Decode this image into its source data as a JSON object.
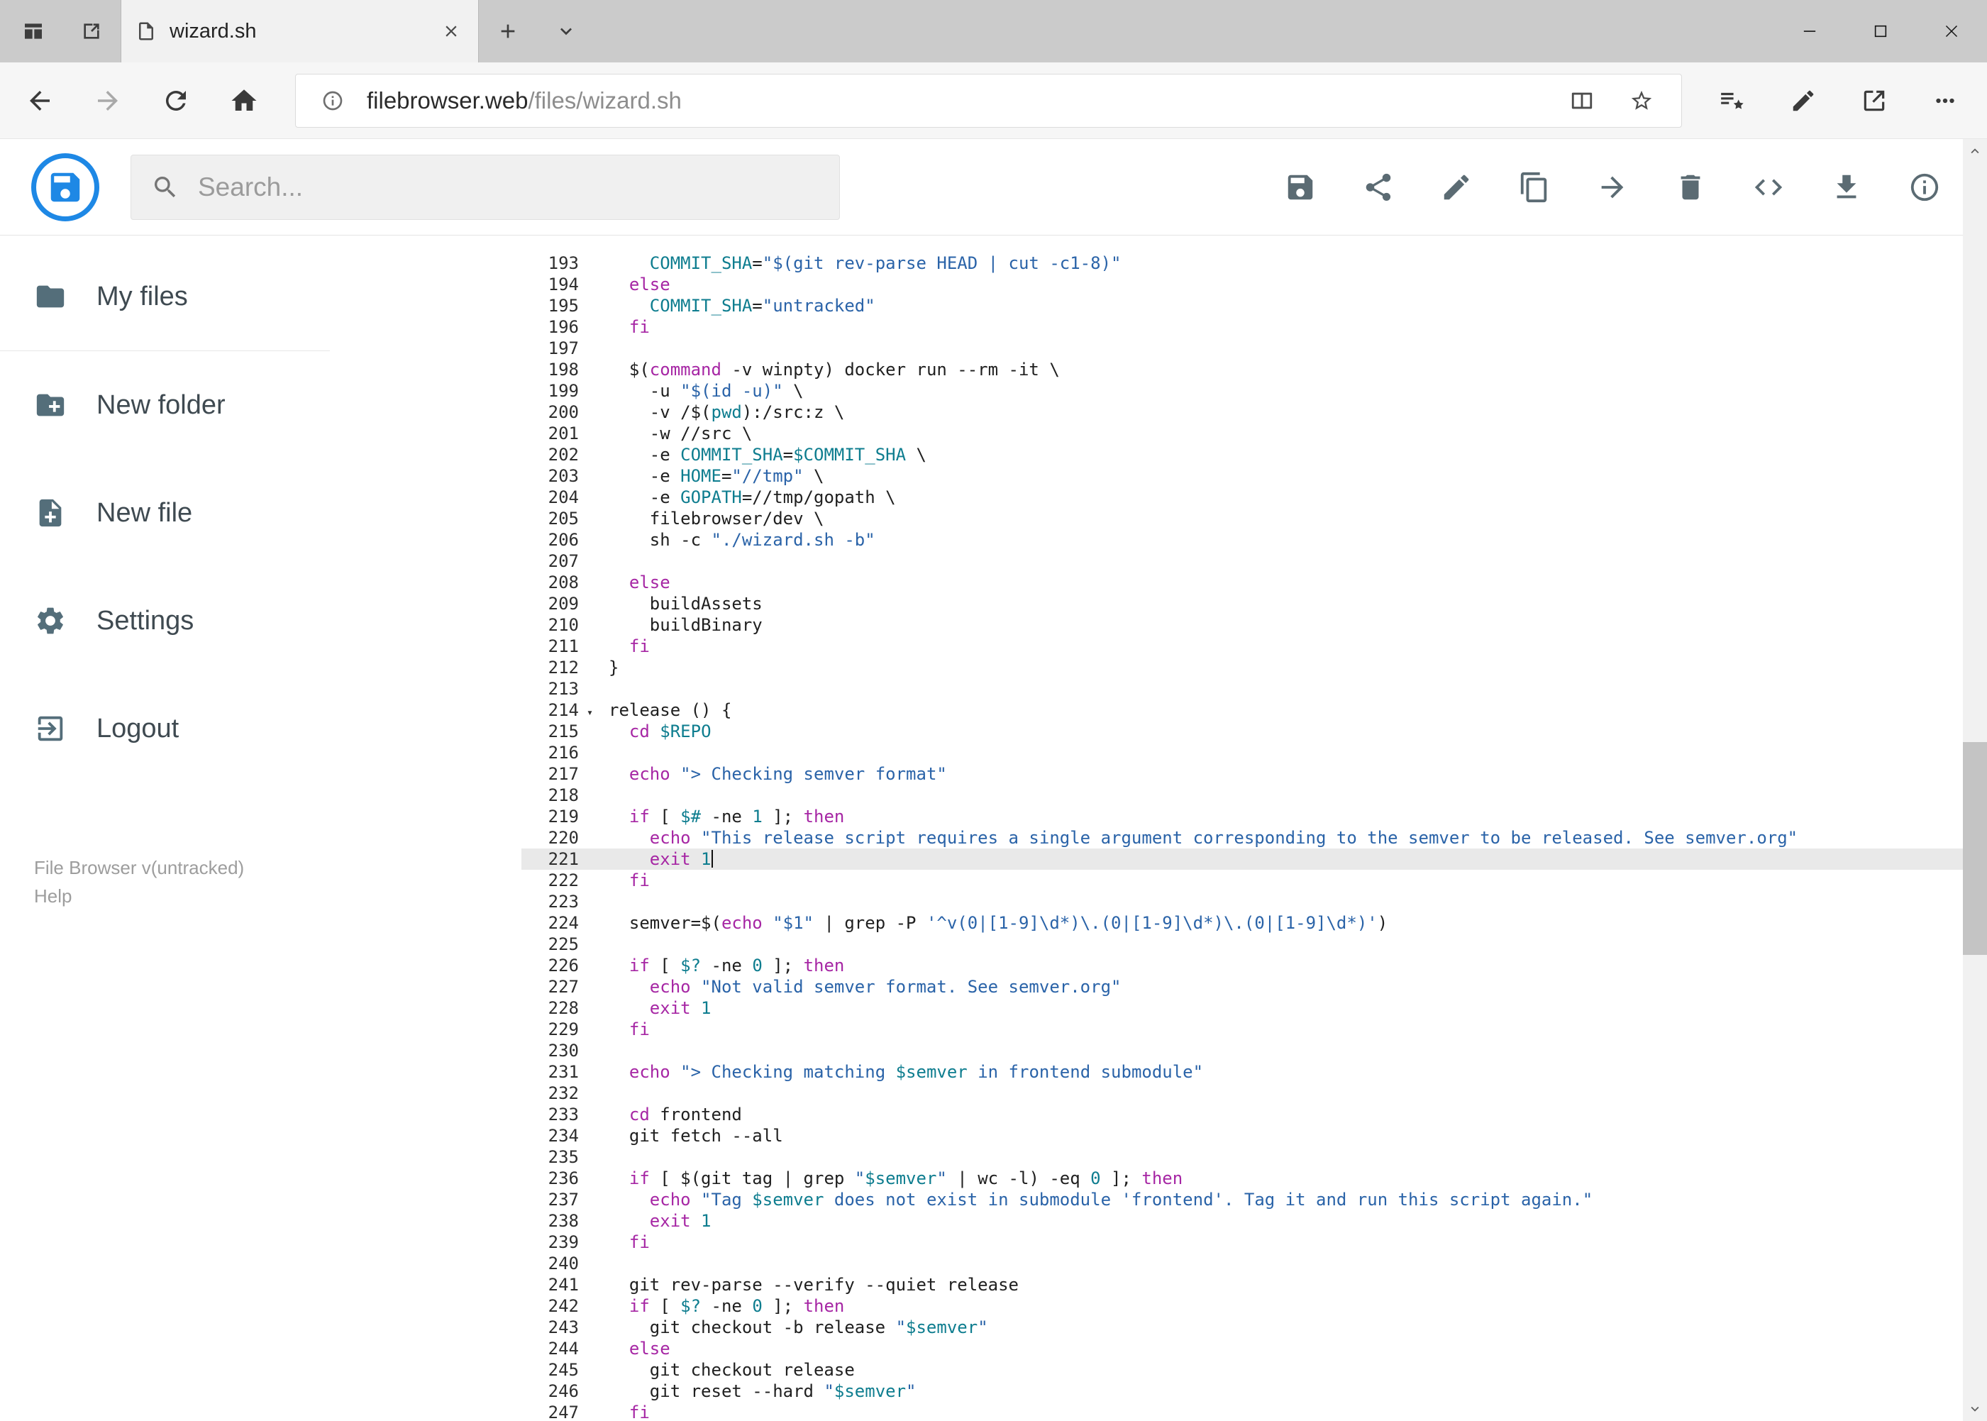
{
  "window": {
    "tab": {
      "title": "wizard.sh"
    }
  },
  "browser": {
    "url_host": "filebrowser.web",
    "url_path": "/files/wizard.sh"
  },
  "theme": {
    "accent_blue": "#1e88e5",
    "keyword": "#a626a4",
    "string": "#2a63a8",
    "variable": "#0e7d8f",
    "number": "#0e7d8f",
    "plain": "#202020",
    "active_line_bg": "#e9e9e9",
    "icon_gray": "#5b6b73"
  },
  "header": {
    "search_placeholder": "Search...",
    "actions": [
      {
        "name": "save-button",
        "icon": "save-icon",
        "symbol": "sym-save"
      },
      {
        "name": "share-button",
        "icon": "share-icon",
        "symbol": "sym-share"
      },
      {
        "name": "rename-button",
        "icon": "pencil-icon",
        "symbol": "sym-pencil"
      },
      {
        "name": "copy-button",
        "icon": "copy-icon",
        "symbol": "sym-copy"
      },
      {
        "name": "move-button",
        "icon": "arrow-right-icon",
        "symbol": "sym-forward"
      },
      {
        "name": "delete-button",
        "icon": "trash-icon",
        "symbol": "sym-trash"
      },
      {
        "name": "editor-mode-button",
        "icon": "code-icon",
        "symbol": "sym-code"
      },
      {
        "name": "download-button",
        "icon": "download-icon",
        "symbol": "sym-download"
      },
      {
        "name": "info-button",
        "icon": "info-icon",
        "symbol": "sym-info"
      }
    ]
  },
  "sidebar": {
    "items": [
      {
        "id": "my-files",
        "label": "My files",
        "icon": "folder-icon",
        "symbol": "sym-folder",
        "divider_after": true
      },
      {
        "id": "new-folder",
        "label": "New folder",
        "icon": "folder-plus-icon",
        "symbol": "sym-folder-plus"
      },
      {
        "id": "new-file",
        "label": "New file",
        "icon": "file-plus-icon",
        "symbol": "sym-file-plus"
      },
      {
        "id": "settings",
        "label": "Settings",
        "icon": "gear-icon",
        "symbol": "sym-gear"
      },
      {
        "id": "logout",
        "label": "Logout",
        "icon": "logout-icon",
        "symbol": "sym-logout"
      }
    ],
    "footer": {
      "version": "File Browser v(untracked)",
      "help": "Help"
    }
  },
  "editor": {
    "active_line": 221,
    "first_visible_line": 193,
    "lines": [
      {
        "n": 193,
        "seg": [
          [
            "p",
            "    "
          ],
          [
            "v",
            "COMMIT_SHA"
          ],
          [
            "p",
            "="
          ],
          [
            "s",
            "\"$(git rev-parse HEAD | cut -c1-8)\""
          ]
        ]
      },
      {
        "n": 194,
        "seg": [
          [
            "p",
            "  "
          ],
          [
            "k",
            "else"
          ]
        ]
      },
      {
        "n": 195,
        "seg": [
          [
            "p",
            "    "
          ],
          [
            "v",
            "COMMIT_SHA"
          ],
          [
            "p",
            "="
          ],
          [
            "s",
            "\"untracked\""
          ]
        ]
      },
      {
        "n": 196,
        "seg": [
          [
            "p",
            "  "
          ],
          [
            "k",
            "fi"
          ]
        ]
      },
      {
        "n": 197,
        "seg": []
      },
      {
        "n": 198,
        "seg": [
          [
            "p",
            "  $("
          ],
          [
            "k",
            "command"
          ],
          [
            "p",
            " -v winpty) docker run --rm -it \\"
          ]
        ]
      },
      {
        "n": 199,
        "seg": [
          [
            "p",
            "    -u "
          ],
          [
            "s",
            "\"$(id -u)\""
          ],
          [
            "p",
            " \\"
          ]
        ]
      },
      {
        "n": 200,
        "seg": [
          [
            "p",
            "    -v /$("
          ],
          [
            "v",
            "pwd"
          ],
          [
            "p",
            "):/src:z \\"
          ]
        ]
      },
      {
        "n": 201,
        "seg": [
          [
            "p",
            "    -w //src \\"
          ]
        ]
      },
      {
        "n": 202,
        "seg": [
          [
            "p",
            "    -e "
          ],
          [
            "v",
            "COMMIT_SHA"
          ],
          [
            "p",
            "="
          ],
          [
            "v",
            "$COMMIT_SHA"
          ],
          [
            "p",
            " \\"
          ]
        ]
      },
      {
        "n": 203,
        "seg": [
          [
            "p",
            "    -e "
          ],
          [
            "v",
            "HOME"
          ],
          [
            "p",
            "="
          ],
          [
            "s",
            "\"//tmp\""
          ],
          [
            "p",
            " \\"
          ]
        ]
      },
      {
        "n": 204,
        "seg": [
          [
            "p",
            "    -e "
          ],
          [
            "v",
            "GOPATH"
          ],
          [
            "p",
            "=//tmp/gopath \\"
          ]
        ]
      },
      {
        "n": 205,
        "seg": [
          [
            "p",
            "    filebrowser/dev \\"
          ]
        ]
      },
      {
        "n": 206,
        "seg": [
          [
            "p",
            "    sh -c "
          ],
          [
            "s",
            "\"./wizard.sh -b\""
          ]
        ]
      },
      {
        "n": 207,
        "seg": []
      },
      {
        "n": 208,
        "seg": [
          [
            "p",
            "  "
          ],
          [
            "k",
            "else"
          ]
        ]
      },
      {
        "n": 209,
        "seg": [
          [
            "p",
            "    buildAssets"
          ]
        ]
      },
      {
        "n": 210,
        "seg": [
          [
            "p",
            "    buildBinary"
          ]
        ]
      },
      {
        "n": 211,
        "seg": [
          [
            "p",
            "  "
          ],
          [
            "k",
            "fi"
          ]
        ]
      },
      {
        "n": 212,
        "seg": [
          [
            "p",
            "}"
          ]
        ]
      },
      {
        "n": 213,
        "seg": []
      },
      {
        "n": 214,
        "fold": true,
        "seg": [
          [
            "p",
            "release () {"
          ]
        ]
      },
      {
        "n": 215,
        "seg": [
          [
            "p",
            "  "
          ],
          [
            "k",
            "cd"
          ],
          [
            "p",
            " "
          ],
          [
            "v",
            "$REPO"
          ]
        ]
      },
      {
        "n": 216,
        "seg": []
      },
      {
        "n": 217,
        "seg": [
          [
            "p",
            "  "
          ],
          [
            "k",
            "echo"
          ],
          [
            "p",
            " "
          ],
          [
            "s",
            "\"> Checking semver format\""
          ]
        ]
      },
      {
        "n": 218,
        "seg": []
      },
      {
        "n": 219,
        "seg": [
          [
            "p",
            "  "
          ],
          [
            "k",
            "if"
          ],
          [
            "p",
            " [ "
          ],
          [
            "v",
            "$#"
          ],
          [
            "p",
            " -ne "
          ],
          [
            "n",
            "1"
          ],
          [
            "p",
            " ]; "
          ],
          [
            "k",
            "then"
          ]
        ]
      },
      {
        "n": 220,
        "seg": [
          [
            "p",
            "    "
          ],
          [
            "k",
            "echo"
          ],
          [
            "p",
            " "
          ],
          [
            "s",
            "\"This release script requires a single argument corresponding to the semver to be released. See semver.org\""
          ]
        ]
      },
      {
        "n": 221,
        "seg": [
          [
            "p",
            "    "
          ],
          [
            "k",
            "exit"
          ],
          [
            "p",
            " "
          ],
          [
            "n",
            "1"
          ]
        ]
      },
      {
        "n": 222,
        "seg": [
          [
            "p",
            "  "
          ],
          [
            "k",
            "fi"
          ]
        ]
      },
      {
        "n": 223,
        "seg": []
      },
      {
        "n": 224,
        "seg": [
          [
            "p",
            "  semver=$("
          ],
          [
            "k",
            "echo"
          ],
          [
            "p",
            " "
          ],
          [
            "s",
            "\"$1\""
          ],
          [
            "p",
            " | grep -P "
          ],
          [
            "s",
            "'^v(0|[1-9]\\d*)\\.(0|[1-9]\\d*)\\.(0|[1-9]\\d*)'"
          ],
          [
            "p",
            ")"
          ]
        ]
      },
      {
        "n": 225,
        "seg": []
      },
      {
        "n": 226,
        "seg": [
          [
            "p",
            "  "
          ],
          [
            "k",
            "if"
          ],
          [
            "p",
            " [ "
          ],
          [
            "v",
            "$?"
          ],
          [
            "p",
            " -ne "
          ],
          [
            "n",
            "0"
          ],
          [
            "p",
            " ]; "
          ],
          [
            "k",
            "then"
          ]
        ]
      },
      {
        "n": 227,
        "seg": [
          [
            "p",
            "    "
          ],
          [
            "k",
            "echo"
          ],
          [
            "p",
            " "
          ],
          [
            "s",
            "\"Not valid semver format. See semver.org\""
          ]
        ]
      },
      {
        "n": 228,
        "seg": [
          [
            "p",
            "    "
          ],
          [
            "k",
            "exit"
          ],
          [
            "p",
            " "
          ],
          [
            "n",
            "1"
          ]
        ]
      },
      {
        "n": 229,
        "seg": [
          [
            "p",
            "  "
          ],
          [
            "k",
            "fi"
          ]
        ]
      },
      {
        "n": 230,
        "seg": []
      },
      {
        "n": 231,
        "seg": [
          [
            "p",
            "  "
          ],
          [
            "k",
            "echo"
          ],
          [
            "p",
            " "
          ],
          [
            "s",
            "\"> Checking matching "
          ],
          [
            "v",
            "$semver"
          ],
          [
            "s",
            " in frontend submodule\""
          ]
        ]
      },
      {
        "n": 232,
        "seg": []
      },
      {
        "n": 233,
        "seg": [
          [
            "p",
            "  "
          ],
          [
            "k",
            "cd"
          ],
          [
            "p",
            " frontend"
          ]
        ]
      },
      {
        "n": 234,
        "seg": [
          [
            "p",
            "  git fetch --all"
          ]
        ]
      },
      {
        "n": 235,
        "seg": []
      },
      {
        "n": 236,
        "seg": [
          [
            "p",
            "  "
          ],
          [
            "k",
            "if"
          ],
          [
            "p",
            " [ $(git tag | grep "
          ],
          [
            "s",
            "\""
          ],
          [
            "v",
            "$semver"
          ],
          [
            "s",
            "\""
          ],
          [
            "p",
            " | wc -l) -eq "
          ],
          [
            "n",
            "0"
          ],
          [
            "p",
            " ]; "
          ],
          [
            "k",
            "then"
          ]
        ]
      },
      {
        "n": 237,
        "seg": [
          [
            "p",
            "    "
          ],
          [
            "k",
            "echo"
          ],
          [
            "p",
            " "
          ],
          [
            "s",
            "\"Tag "
          ],
          [
            "v",
            "$semver"
          ],
          [
            "s",
            " does not exist in submodule 'frontend'. Tag it and run this script again.\""
          ]
        ]
      },
      {
        "n": 238,
        "seg": [
          [
            "p",
            "    "
          ],
          [
            "k",
            "exit"
          ],
          [
            "p",
            " "
          ],
          [
            "n",
            "1"
          ]
        ]
      },
      {
        "n": 239,
        "seg": [
          [
            "p",
            "  "
          ],
          [
            "k",
            "fi"
          ]
        ]
      },
      {
        "n": 240,
        "seg": []
      },
      {
        "n": 241,
        "seg": [
          [
            "p",
            "  git rev-parse --verify --quiet release"
          ]
        ]
      },
      {
        "n": 242,
        "seg": [
          [
            "p",
            "  "
          ],
          [
            "k",
            "if"
          ],
          [
            "p",
            " [ "
          ],
          [
            "v",
            "$?"
          ],
          [
            "p",
            " -ne "
          ],
          [
            "n",
            "0"
          ],
          [
            "p",
            " ]; "
          ],
          [
            "k",
            "then"
          ]
        ]
      },
      {
        "n": 243,
        "seg": [
          [
            "p",
            "    git checkout -b release "
          ],
          [
            "s",
            "\""
          ],
          [
            "v",
            "$semver"
          ],
          [
            "s",
            "\""
          ]
        ]
      },
      {
        "n": 244,
        "seg": [
          [
            "p",
            "  "
          ],
          [
            "k",
            "else"
          ]
        ]
      },
      {
        "n": 245,
        "seg": [
          [
            "p",
            "    git checkout release"
          ]
        ]
      },
      {
        "n": 246,
        "seg": [
          [
            "p",
            "    git reset --hard "
          ],
          [
            "s",
            "\""
          ],
          [
            "v",
            "$semver"
          ],
          [
            "s",
            "\""
          ]
        ]
      },
      {
        "n": 247,
        "seg": [
          [
            "p",
            "  "
          ],
          [
            "k",
            "fi"
          ]
        ]
      }
    ]
  }
}
